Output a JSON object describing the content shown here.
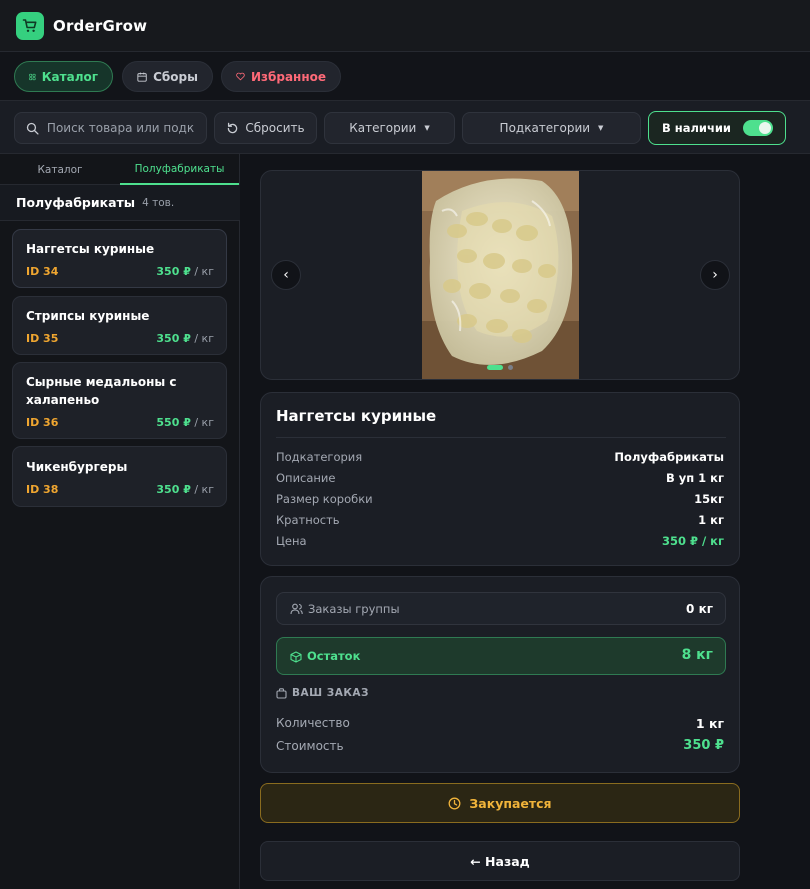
{
  "app": {
    "title": "OrderGrow"
  },
  "nav": {
    "tabs": [
      {
        "label": "Каталог"
      },
      {
        "label": "Сборы"
      },
      {
        "label": "Избранное"
      }
    ]
  },
  "filters": {
    "search_placeholder": "Поиск товара или подк",
    "reset_label": "Сбросить",
    "categories_label": "Категории",
    "subcategories_label": "Подкатегории",
    "in_stock_label": "В наличии",
    "in_stock_on": true
  },
  "sidebar": {
    "tabs": [
      {
        "label": "Каталог"
      },
      {
        "label": "Полуфабрикаты"
      }
    ],
    "section_title": "Полуфабрикаты",
    "section_count": "4 тов.",
    "products": [
      {
        "name": "Наггетсы куриные",
        "id": "ID 34",
        "price": "350 ₽",
        "unit": "/ кг"
      },
      {
        "name": "Стрипсы куриные",
        "id": "ID 35",
        "price": "350 ₽",
        "unit": "/ кг"
      },
      {
        "name": "Сырные медальоны с халапеньо",
        "id": "ID 36",
        "price": "550 ₽",
        "unit": "/ кг"
      },
      {
        "name": "Чикенбургеры",
        "id": "ID 38",
        "price": "350 ₽",
        "unit": "/ кг"
      }
    ]
  },
  "detail": {
    "title": "Наггетсы куриные",
    "rows": [
      {
        "label": "Подкатегория",
        "value": "Полуфабрикаты"
      },
      {
        "label": "Описание",
        "value": "В уп 1 кг"
      },
      {
        "label": "Размер коробки",
        "value": "15кг"
      },
      {
        "label": "Кратность",
        "value": "1 кг"
      },
      {
        "label": "Цена",
        "value": "350 ₽ / кг"
      }
    ]
  },
  "order": {
    "group_orders_label": "Заказы группы",
    "group_orders_value": "0 кг",
    "stock_label": "Остаток",
    "stock_value": "8 кг",
    "your_order_label": "ВАШ ЗАКАЗ",
    "quantity_label": "Количество",
    "quantity_value": "1 кг",
    "cost_label": "Стоимость",
    "cost_value": "350 ₽"
  },
  "actions": {
    "buy_label": "Закупается",
    "back_label": "← Назад"
  },
  "colors": {
    "accent_green": "#4ee08e",
    "id_orange": "#f0a630",
    "buy_gold": "#f0b33a",
    "fav_red": "#ff6a78"
  },
  "icons": {
    "logo": "cart-icon",
    "catalog": "grid-icon",
    "collections": "calendar-icon",
    "favorites": "heart-icon",
    "search": "search-icon",
    "reset": "refresh-icon",
    "group": "users-icon",
    "stock": "box-icon",
    "order": "bag-icon",
    "buy": "clock-icon"
  }
}
